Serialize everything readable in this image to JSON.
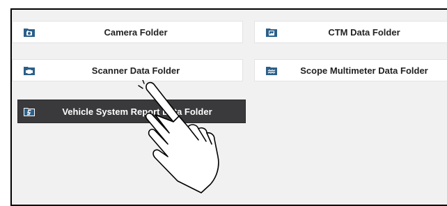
{
  "folders": [
    {
      "label": "Camera Folder",
      "icon": "camera-folder-icon"
    },
    {
      "label": "CTM Data Folder",
      "icon": "image-folder-icon"
    },
    {
      "label": "Scanner Data Folder",
      "icon": "scanner-folder-icon"
    },
    {
      "label": "Scope Multimeter Data Folder",
      "icon": "waveform-folder-icon"
    },
    {
      "label": "Vehicle System Report Data Folder",
      "icon": "report-folder-icon",
      "selected": true
    }
  ],
  "pointer": {
    "icon": "tap-hand-icon"
  },
  "colors": {
    "background": "#f1f1f2",
    "button": "#ffffff",
    "selected_button": "#3a3a3c",
    "icon_blue": "#2b5f8a"
  }
}
